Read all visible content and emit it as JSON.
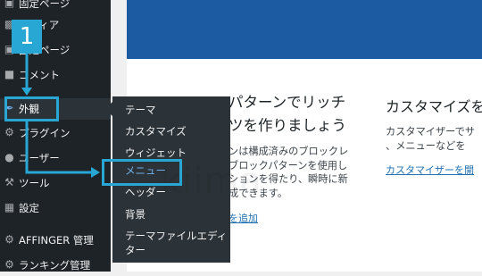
{
  "sidebar": {
    "items": [
      {
        "label": "固定ページ",
        "icon": "pages-icon"
      },
      {
        "label": "メディア",
        "icon": "media-icon"
      },
      {
        "label": "固定ページ",
        "icon": "pages-icon"
      },
      {
        "label": "コメント",
        "icon": "comments-icon"
      },
      {
        "label": "外観",
        "icon": "appearance-icon"
      },
      {
        "label": "プラグイン",
        "icon": "plugins-icon"
      },
      {
        "label": "ユーザー",
        "icon": "users-icon"
      },
      {
        "label": "ツール",
        "icon": "tools-icon"
      },
      {
        "label": "設定",
        "icon": "settings-icon"
      },
      {
        "label": "AFFINGER 管理",
        "icon": "gear-icon"
      },
      {
        "label": "ランキング管理",
        "icon": "ranking-icon"
      }
    ]
  },
  "flyout": {
    "items": [
      {
        "label": "テーマ"
      },
      {
        "label": "カスタマイズ"
      },
      {
        "label": "ウィジェット"
      },
      {
        "label": "メニュー"
      },
      {
        "label": "ヘッダー"
      },
      {
        "label": "背景"
      },
      {
        "label": "テーマファイルエディ"
      },
      {
        "label": "ター"
      }
    ]
  },
  "main": {
    "col1": {
      "title_line1": "パターンでリッチ",
      "title_line2": "ツを作りましょう",
      "body": "ンは構成済みのブロックレブロックパターンを使用しションを得たり、瞬時に新成できます。",
      "body_lines": [
        "ンは構成済みのブロックレ",
        "ブロックパターンを使用し",
        "ションを得たり、瞬時に新",
        "成できます。"
      ],
      "link": "を追加"
    },
    "col2": {
      "title": "カスタマイズを",
      "body_lines": [
        "カスタマイザーでサ",
        "、メニューなどを",
        ""
      ],
      "link": "カスタマイザーを開"
    }
  },
  "annotation": {
    "step_number": "1"
  },
  "colors": {
    "sidebar_bg": "#1d2327",
    "flyout_bg": "#2c3338",
    "highlight": "#28a7d4",
    "hero_blue": "#1c5ba1",
    "link": "#2271b1"
  }
}
